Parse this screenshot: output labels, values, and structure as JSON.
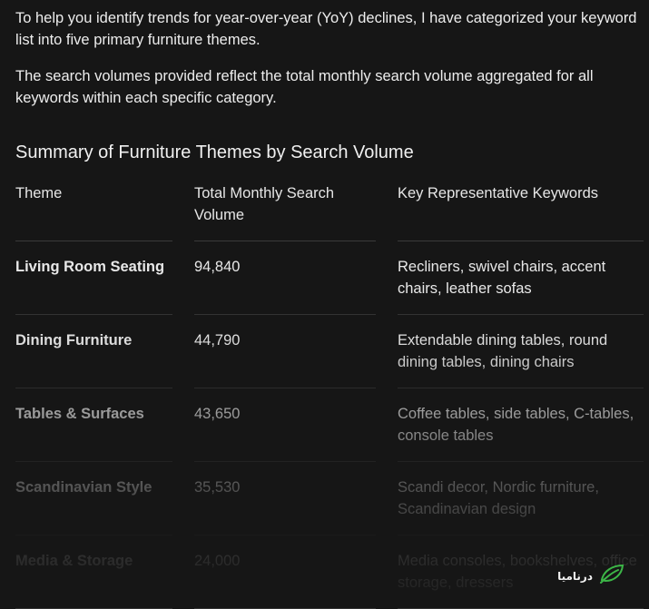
{
  "intro": {
    "paragraph1": "To help you identify trends for year-over-year (YoY) declines, I have categorized your keyword list into five primary furniture themes.",
    "paragraph2": "The search volumes provided reflect the total monthly search volume aggregated for all keywords within each specific category."
  },
  "section_heading": "Summary of Furniture Themes by Search Volume",
  "table": {
    "headers": [
      "Theme",
      "Total Monthly Search Volume",
      "Key Representative Keywords"
    ],
    "rows": [
      {
        "theme": "Living Room Seating",
        "volume": "94,840",
        "keywords": "Recliners, swivel chairs, accent chairs, leather sofas"
      },
      {
        "theme": "Dining Furniture",
        "volume": "44,790",
        "keywords": "Extendable dining tables, round dining tables, dining chairs"
      },
      {
        "theme": "Tables & Surfaces",
        "volume": "43,650",
        "keywords": "Coffee tables, side tables, C-tables, console tables"
      },
      {
        "theme": "Scandinavian Style",
        "volume": "35,530",
        "keywords": "Scandi decor, Nordic furniture, Scandinavian design"
      },
      {
        "theme": "Media & Storage",
        "volume": "24,000",
        "keywords": "Media consoles, bookshelves, office storage, dressers"
      }
    ]
  },
  "watermark": {
    "text": "درنامیا",
    "icon": "leaf-logo-icon",
    "color": "#3fbf4a"
  },
  "colors": {
    "background": "#161616",
    "text": "#ededed",
    "divider": "#333333"
  }
}
